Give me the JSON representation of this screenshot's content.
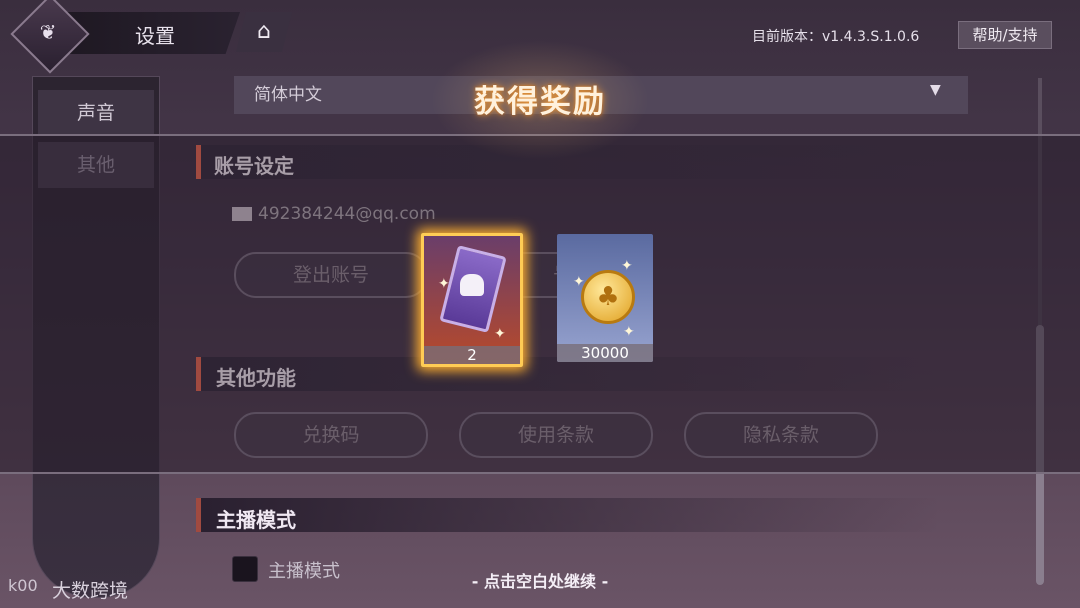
{
  "header": {
    "title": "设置",
    "version": "目前版本：v1.4.3.S.1.0.6",
    "help_label": "帮助/支持",
    "home_icon": "home-icon"
  },
  "sidebar": {
    "items": [
      {
        "label": "声音"
      },
      {
        "label": "其他"
      }
    ]
  },
  "language": {
    "selected": "简体中文"
  },
  "reward": {
    "title": "获得奖励",
    "items": [
      {
        "icon": "ticket-icon",
        "quantity": "2"
      },
      {
        "icon": "coin-icon",
        "quantity": "30000"
      }
    ],
    "continue_hint": "- 点击空白处继续 -"
  },
  "account": {
    "header": "账号设定",
    "email": "492384244@qq.com",
    "logout_label": "登出账号",
    "bind_label_partial": "号"
  },
  "other_functions": {
    "header": "其他功能",
    "buttons": [
      "兑换码",
      "使用条款",
      "隐私条款"
    ]
  },
  "streamer": {
    "header": "主播模式",
    "option_label": "主播模式"
  },
  "watermark": {
    "text": "大数跨境",
    "logo": "k00"
  }
}
